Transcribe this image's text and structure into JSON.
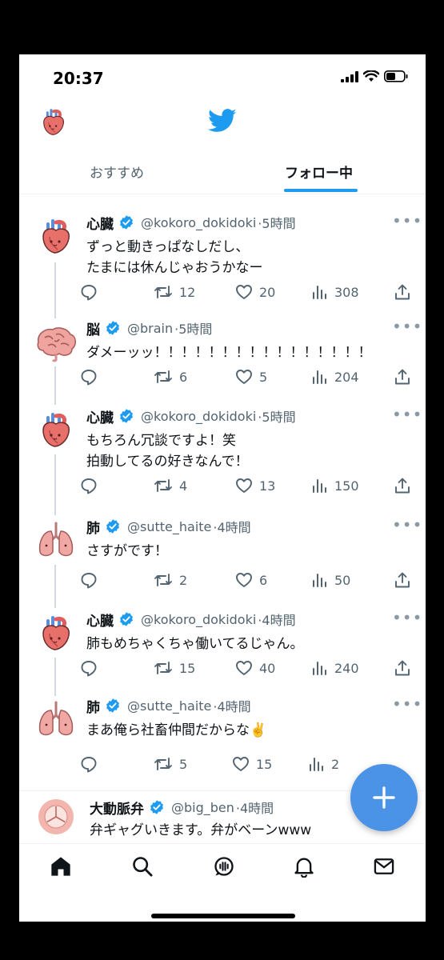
{
  "status": {
    "time": "20:37"
  },
  "tabs": [
    {
      "label": "おすすめ",
      "active": false
    },
    {
      "label": "フォロー中",
      "active": true
    }
  ],
  "tweets": [
    {
      "name": "心臓",
      "handle": "@kokoro_dokidoki",
      "time": "·5時間",
      "avatar": "heart-icon",
      "text": "ずっと動きっぱなしだし、\nたまには休んじゃおうかなー",
      "retweets": "12",
      "likes": "20",
      "views": "308"
    },
    {
      "name": "脳",
      "handle": "@brain",
      "time": "·5時間",
      "avatar": "brain-icon",
      "text": "ダメーッッ！！！！！！！！！！！！！！！！",
      "retweets": "6",
      "likes": "5",
      "views": "204"
    },
    {
      "name": "心臓",
      "handle": "@kokoro_dokidoki",
      "time": "·5時間",
      "avatar": "heart-icon",
      "text": "もちろん冗談ですよ！笑\n拍動してるの好きなんで！",
      "retweets": "4",
      "likes": "13",
      "views": "150"
    },
    {
      "name": "肺",
      "handle": "@sutte_haite",
      "time": "·4時間",
      "avatar": "lungs-icon",
      "text": "さすがです！",
      "retweets": "2",
      "likes": "6",
      "views": "50"
    },
    {
      "name": "心臓",
      "handle": "@kokoro_dokidoki",
      "time": "·4時間",
      "avatar": "heart-icon",
      "text": "肺もめちゃくちゃ働いてるじゃん。",
      "retweets": "15",
      "likes": "40",
      "views": "240"
    },
    {
      "name": "肺",
      "handle": "@sutte_haite",
      "time": "·4時間",
      "avatar": "lungs-icon",
      "text": "まあ俺ら社畜仲間だからな✌️",
      "retweets": "5",
      "likes": "15",
      "views": "2"
    },
    {
      "name": "大動脈弁",
      "handle": "@big_ben",
      "time": "·4時間",
      "avatar": "valve-icon",
      "text": "弁ギャグいきます。弁がベーンwww",
      "retweets": "",
      "likes": "",
      "views": ""
    }
  ],
  "fab": {
    "label": "+"
  },
  "colors": {
    "accent": "#1d9bf0",
    "fab": "#4a93e6",
    "verified": "#1d9bf0"
  }
}
